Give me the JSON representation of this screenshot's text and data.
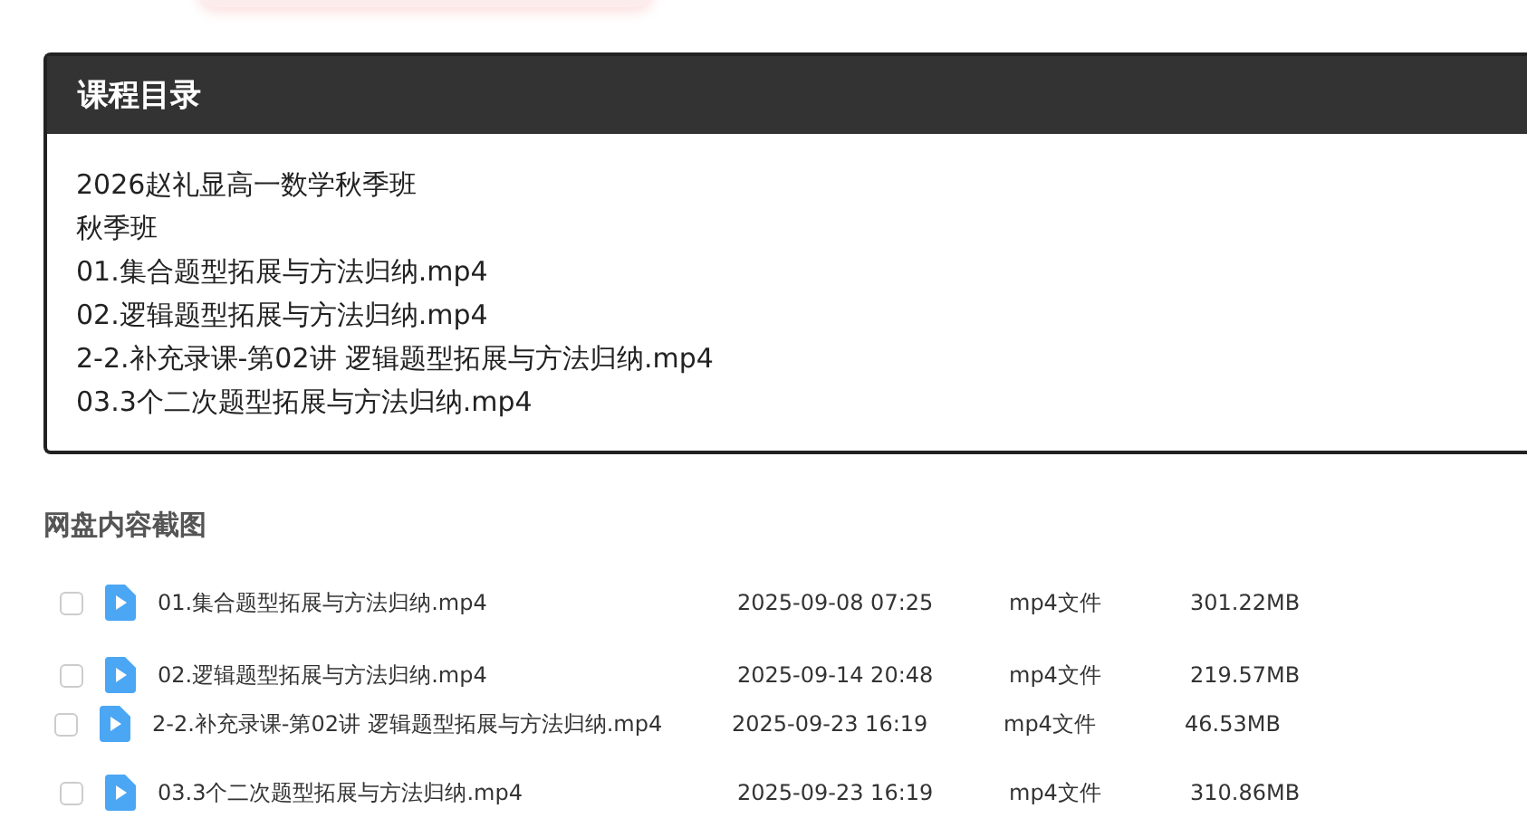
{
  "catalog": {
    "title": "课程目录",
    "lines": [
      "2026赵礼显高一数学秋季班",
      "秋季班",
      "01.集合题型拓展与方法归纳.mp4",
      "02.逻辑题型拓展与方法归纳.mp4",
      "2-2.补充录课-第02讲 逻辑题型拓展与方法归纳.mp4",
      "03.3个二次题型拓展与方法归纳.mp4"
    ]
  },
  "screenshot_section": {
    "title": "网盘内容截图"
  },
  "files": [
    {
      "name": "01.集合题型拓展与方法归纳.mp4",
      "date": "2025-09-08 07:25",
      "type": "mp4文件",
      "size": "301.22MB",
      "checked": false
    },
    {
      "name": "02.逻辑题型拓展与方法归纳.mp4",
      "date": "2025-09-14 20:48",
      "type": "mp4文件",
      "size": "219.57MB",
      "checked": false
    },
    {
      "name": "2-2.补充录课-第02讲 逻辑题型拓展与方法归纳.mp4",
      "date": "2025-09-23 16:19",
      "type": "mp4文件",
      "size": "46.53MB",
      "checked": false
    },
    {
      "name": "03.3个二次题型拓展与方法归纳.mp4",
      "date": "2025-09-23 16:19",
      "type": "mp4文件",
      "size": "310.86MB",
      "checked": false
    }
  ]
}
